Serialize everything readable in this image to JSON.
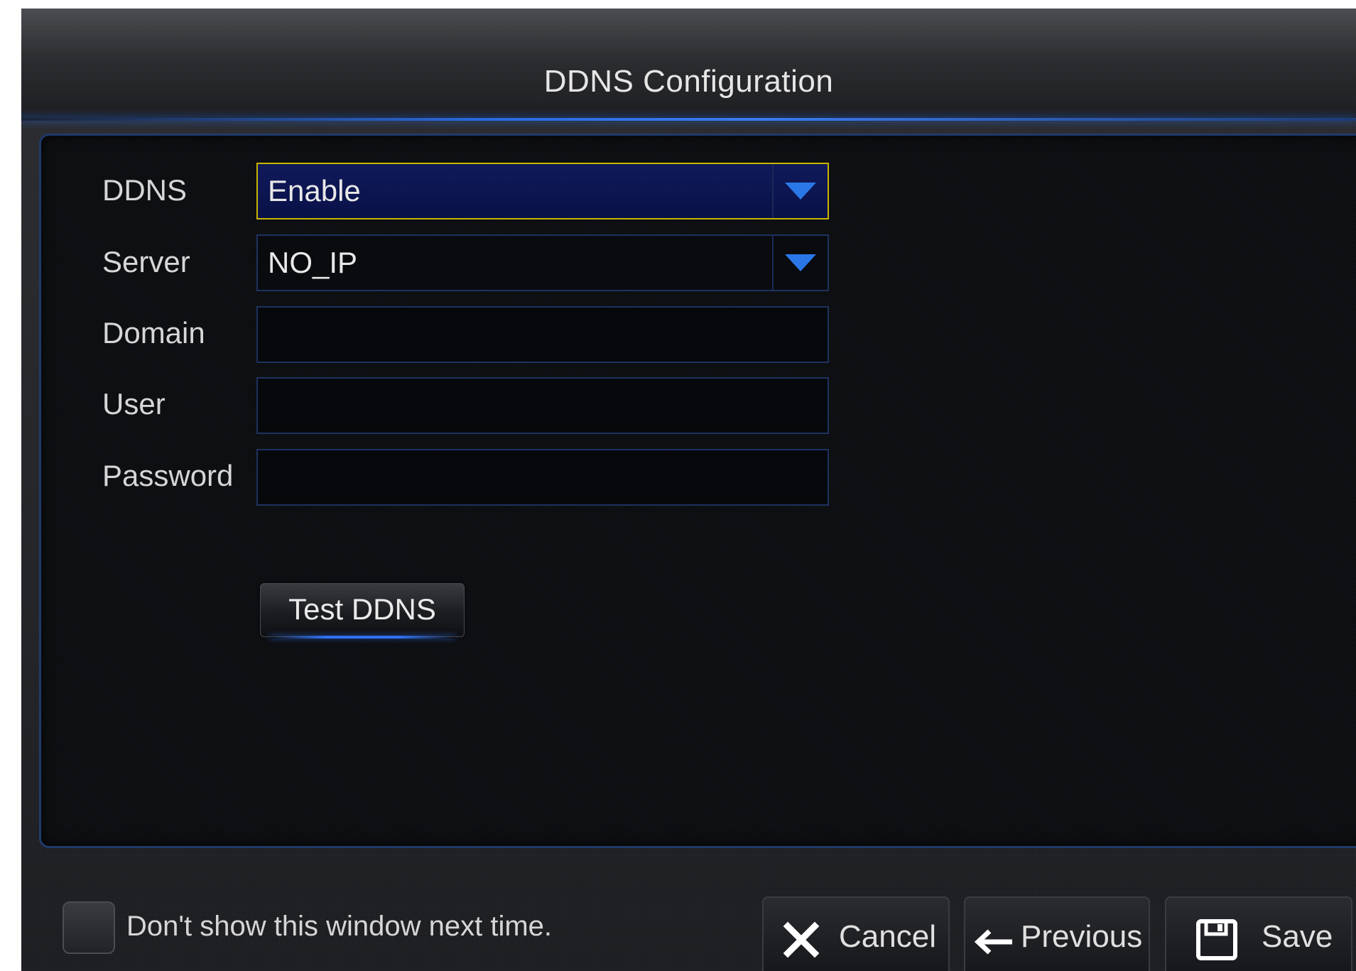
{
  "window": {
    "title": "DDNS Configuration"
  },
  "form": {
    "ddns": {
      "label": "DDNS",
      "value": "Enable"
    },
    "server": {
      "label": "Server",
      "value": "NO_IP"
    },
    "domain": {
      "label": "Domain",
      "value": ""
    },
    "user": {
      "label": "User",
      "value": ""
    },
    "password": {
      "label": "Password",
      "value": ""
    },
    "test_button": "Test DDNS"
  },
  "footer": {
    "checkbox_label": "Don't show this window next time.",
    "checkbox_checked": false,
    "cancel_label": "Cancel",
    "previous_label": "Previous",
    "save_label": "Save"
  },
  "icons": {
    "dropdown": "chevron-down-icon",
    "cancel": "close-icon",
    "previous": "arrow-left-icon",
    "save": "floppy-disk-icon"
  },
  "colors": {
    "accent_blue": "#2f70f0",
    "focus_border": "#c8b400",
    "focused_field_bg": "#0a1148"
  }
}
